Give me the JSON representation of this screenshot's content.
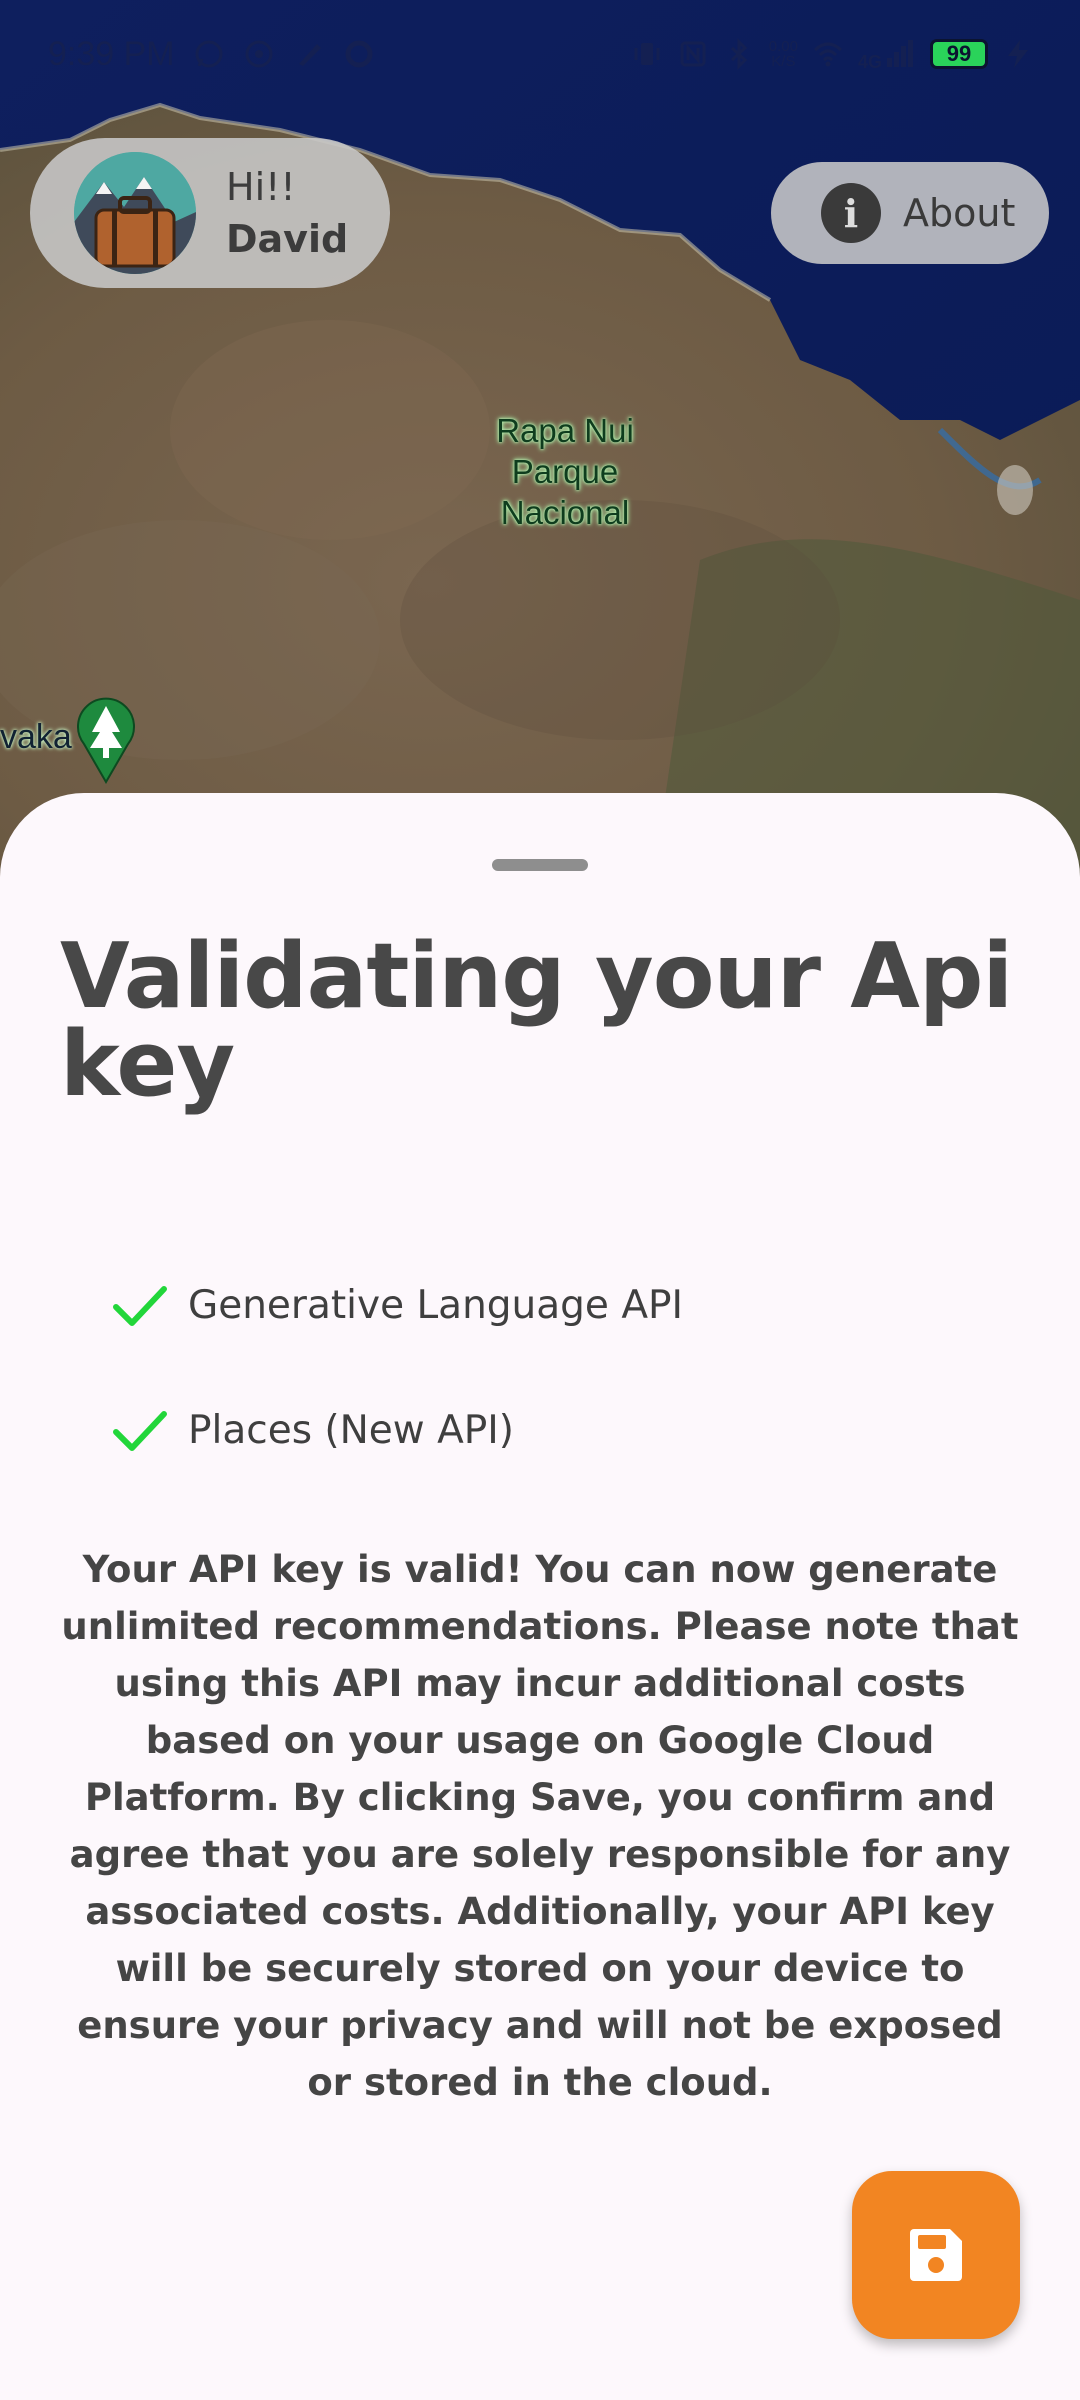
{
  "status_bar": {
    "time": "9:39 PM",
    "net_speed_value": "0.00",
    "net_speed_unit": "K/S",
    "network_type": "4G",
    "battery_level": "99",
    "left_icons": [
      "whatsapp-icon",
      "chat-bubble-icon",
      "pen-icon",
      "circle-icon"
    ],
    "right_icons": [
      "vibrate-icon",
      "nfc-icon",
      "bluetooth-icon",
      "wifi-icon",
      "signal-icon",
      "charging-icon"
    ]
  },
  "greeting": {
    "hello": "Hi!!",
    "name": "David"
  },
  "about_button": {
    "label": "About",
    "icon": "info-icon"
  },
  "map": {
    "park_label": "Rapa Nui\nParque\nNacional",
    "partial_place_label": "vaka",
    "pin_icon": "tree-pin-icon"
  },
  "sheet": {
    "title": "Validating your Api key",
    "checks": [
      {
        "label": "Generative Language API",
        "status": "valid"
      },
      {
        "label": "Places (New API)",
        "status": "valid"
      }
    ],
    "body": "Your API key is valid! You can now generate unlimited recommendations. Please note that using this API may incur additional costs based on your usage on Google Cloud Platform. By clicking Save, you confirm and agree that you are solely responsible for any associated costs. Additionally, your API key will be securely stored on your device to ensure your privacy and will not be exposed or stored in the cloud.",
    "save_icon": "floppy-disk-icon"
  },
  "colors": {
    "accent": "#f28522",
    "check": "#22d63a",
    "sheet_bg": "#fdf8fc",
    "text": "#454545"
  }
}
